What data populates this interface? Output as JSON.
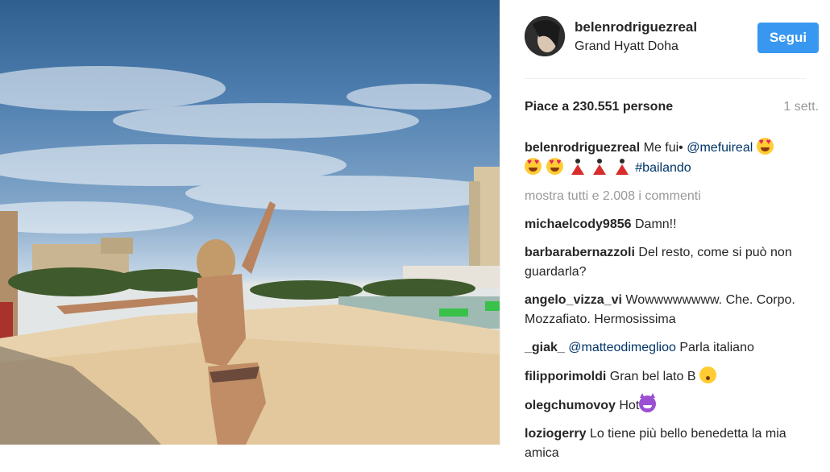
{
  "post": {
    "image_alt": "beach photo"
  },
  "header": {
    "username": "belenrodriguezreal",
    "location": "Grand Hyatt Doha",
    "follow_label": "Segui"
  },
  "stats": {
    "likes_text": "Piace a 230.551 persone",
    "time_ago": "1 sett."
  },
  "caption": {
    "user": "belenrodriguezreal",
    "text": "Me fui•",
    "mention": "@mefuireal",
    "hashtag": "#bailando"
  },
  "load_more": "mostra tutti e 2.008 i commenti",
  "comments": [
    {
      "user": "michaelcody9856",
      "text": "Damn!!"
    },
    {
      "user": "barbarabernazzoli",
      "text": "Del resto, come si può non guardarla?"
    },
    {
      "user": "angelo_vizza_vi",
      "text": "Wowwwwwwww. Che. Corpo. Mozzafiato. Hermosissima"
    },
    {
      "user": "_giak_",
      "mention": "@matteodimeglioo",
      "text": "Parla italiano"
    },
    {
      "user": "filipporimoldi",
      "text": "Gran bel lato B"
    },
    {
      "user": "olegchumovoy",
      "text": "Hot"
    },
    {
      "user": "loziogerry",
      "text": "Lo tiene più bello benedetta la mia amica"
    }
  ],
  "colors": {
    "accent": "#3897f0",
    "link": "#003569",
    "muted": "#999999",
    "text": "#262626"
  },
  "icons": [
    "heart-eyes-emoji",
    "dancer-emoji",
    "hushed-face-emoji",
    "smiling-devil-emoji"
  ]
}
